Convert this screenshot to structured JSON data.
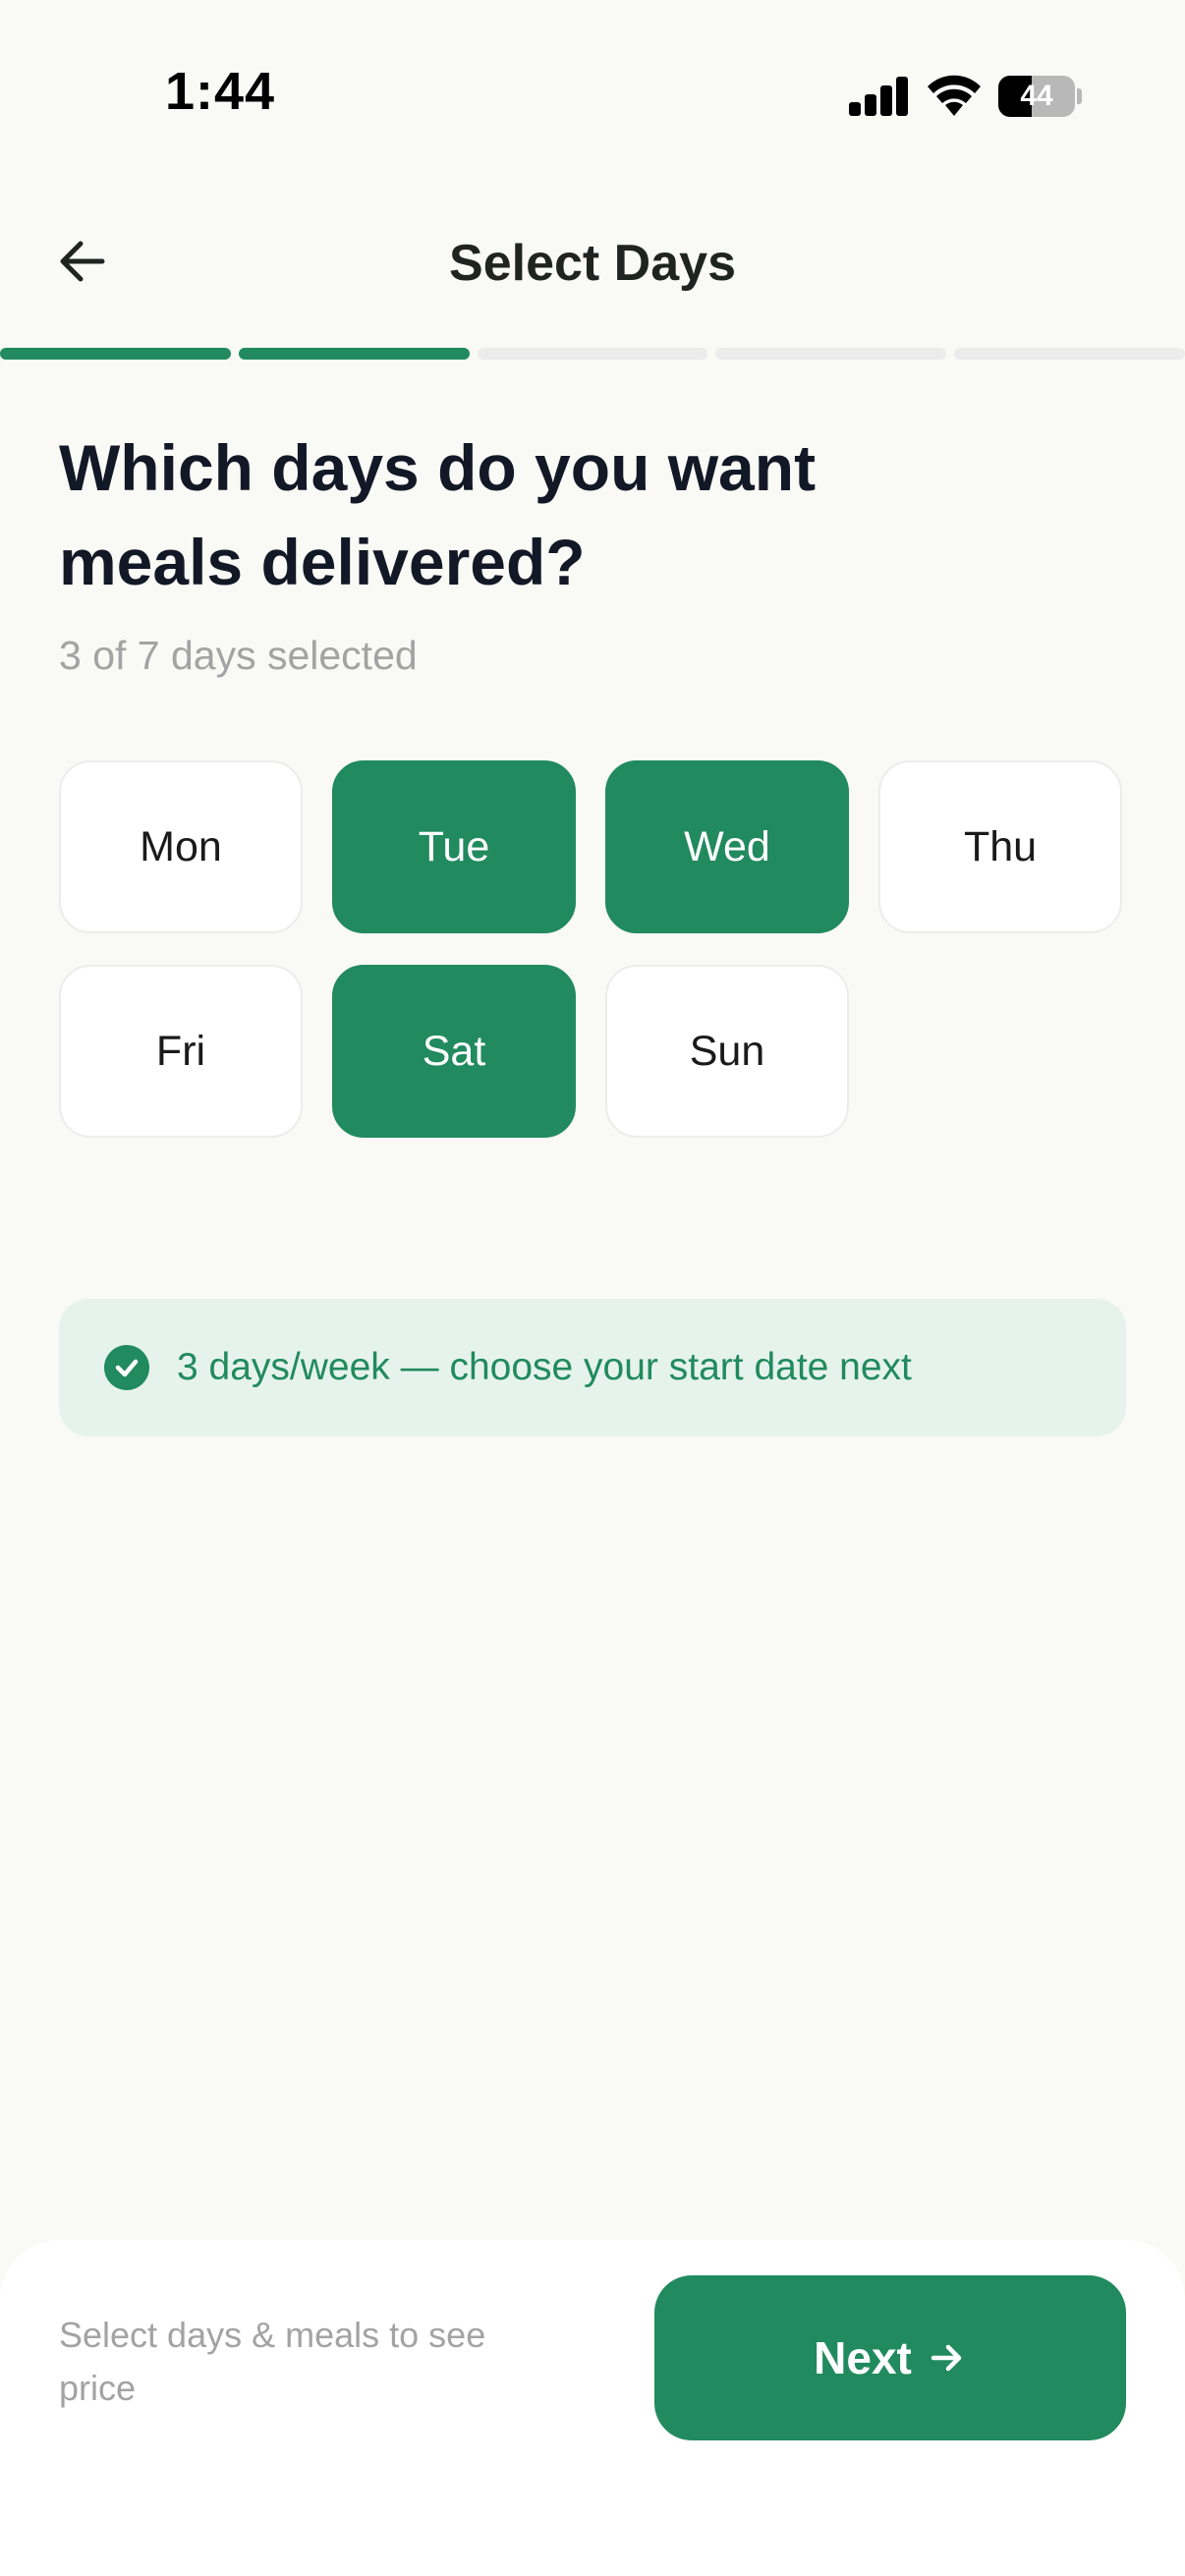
{
  "status_bar": {
    "time": "1:44",
    "battery_level": "44",
    "battery_fraction": 0.44
  },
  "header": {
    "title": "Select Days",
    "back_icon": "arrow-left-icon"
  },
  "progress": {
    "total_steps": 5,
    "completed_steps": 2,
    "accent_color": "#218a5e"
  },
  "question": {
    "title": "Which days do you want meals delivered?",
    "subtext": "3 of 7 days selected"
  },
  "days": [
    {
      "label": "Mon",
      "selected": false
    },
    {
      "label": "Tue",
      "selected": true
    },
    {
      "label": "Wed",
      "selected": true
    },
    {
      "label": "Thu",
      "selected": false
    },
    {
      "label": "Fri",
      "selected": false
    },
    {
      "label": "Sat",
      "selected": true
    },
    {
      "label": "Sun",
      "selected": false
    }
  ],
  "banner": {
    "icon": "check-circle-icon",
    "text": "3 days/week — choose your start date next"
  },
  "footer": {
    "price_hint": "Select days & meals to see price",
    "next_label": "Next",
    "next_icon": "arrow-right-icon"
  }
}
